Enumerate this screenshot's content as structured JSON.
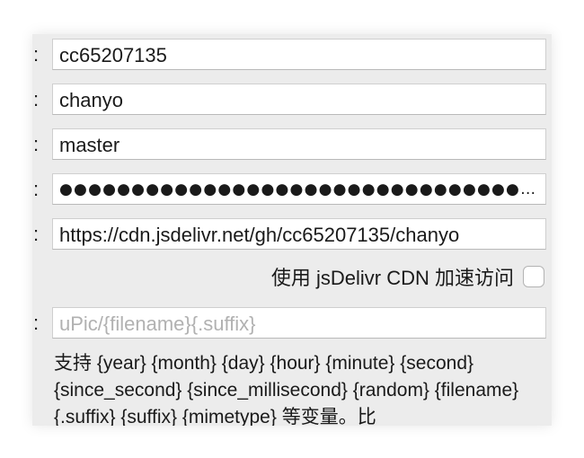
{
  "form": {
    "repo_owner": "cc65207135",
    "repo_name": "chanyo",
    "branch": "master",
    "token_masked": "●●●●●●●●●●●●●●●●●●●●●●●●●●●●●●●●●●●●●●●●●●●●●",
    "domain": "https://cdn.jsdelivr.net/gh/cc65207135/chanyo",
    "cdn_label": "使用 jsDelivr CDN 加速访问",
    "cdn_enabled": false,
    "path_placeholder": "uPic/{filename}{.suffix}",
    "path_value": "",
    "help_text": "支持 {year} {month} {day} {hour} {minute} {second} {since_second} {since_millisecond} {random} {filename} {.suffix} {suffix} {mimetype} 等变量。比"
  },
  "labels": {
    "colon": ":"
  }
}
